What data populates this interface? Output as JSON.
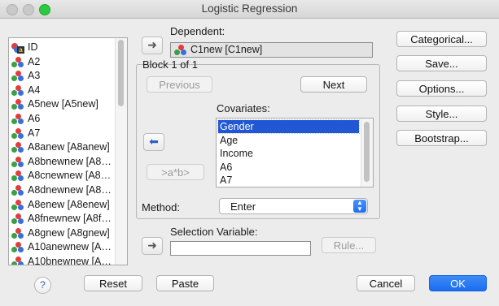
{
  "window": {
    "title": "Logistic Regression"
  },
  "variables": [
    {
      "label": "ID",
      "icon": "id-nominal-icon"
    },
    {
      "label": "A2",
      "icon": "nominal-variable-icon"
    },
    {
      "label": "A3",
      "icon": "nominal-variable-icon"
    },
    {
      "label": "A4",
      "icon": "nominal-variable-icon"
    },
    {
      "label": "A5new [A5new]",
      "icon": "nominal-variable-icon"
    },
    {
      "label": "A6",
      "icon": "nominal-variable-icon"
    },
    {
      "label": "A7",
      "icon": "nominal-variable-icon"
    },
    {
      "label": "A8anew [A8anew]",
      "icon": "nominal-variable-icon"
    },
    {
      "label": "A8bnewnew [A8…",
      "icon": "nominal-variable-icon"
    },
    {
      "label": "A8cnewnew [A8…",
      "icon": "nominal-variable-icon"
    },
    {
      "label": "A8dnewnew [A8…",
      "icon": "nominal-variable-icon"
    },
    {
      "label": "A8enew [A8enew]",
      "icon": "nominal-variable-icon"
    },
    {
      "label": "A8fnewnew [A8f…",
      "icon": "nominal-variable-icon"
    },
    {
      "label": "A8gnew [A8gnew]",
      "icon": "nominal-variable-icon"
    },
    {
      "label": "A10anewnew [A…",
      "icon": "nominal-variable-icon"
    },
    {
      "label": "A10bnewnew [A…",
      "icon": "nominal-variable-icon"
    }
  ],
  "dependent": {
    "label": "Dependent:",
    "value": "C1new [C1new]"
  },
  "block": {
    "label": "Block 1 of 1",
    "previous_label": "Previous",
    "next_label": "Next",
    "interaction_label": ">a*b>",
    "covariates_label": "Covariates:",
    "covariates": [
      "Gender",
      "Age",
      "Income",
      "A6",
      "A7"
    ],
    "selected_covariate": "Gender"
  },
  "method": {
    "label": "Method:",
    "value": "Enter"
  },
  "selection": {
    "label": "Selection Variable:",
    "value": "",
    "rule_label": "Rule..."
  },
  "side_buttons": {
    "categorical": "Categorical...",
    "save": "Save...",
    "options": "Options...",
    "style": "Style...",
    "bootstrap": "Bootstrap..."
  },
  "footer": {
    "help": "?",
    "reset": "Reset",
    "paste": "Paste",
    "cancel": "Cancel",
    "ok": "OK"
  }
}
